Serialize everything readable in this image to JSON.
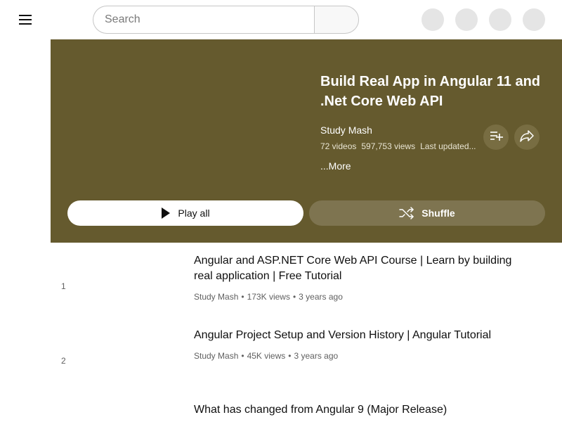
{
  "header": {
    "search_placeholder": "Search"
  },
  "playlist": {
    "title": "Build Real App in Angular 11 and .Net Core Web API",
    "channel": "Study Mash",
    "video_count": "72 videos",
    "views": "597,753 views",
    "last_updated": "Last updated...",
    "more_label": "...More",
    "play_all_label": "Play all",
    "shuffle_label": "Shuffle",
    "background_color": "#655a2e"
  },
  "videos": [
    {
      "index": "1",
      "title": "Angular and ASP.NET Core Web API Course | Learn by building real application | Free Tutorial",
      "channel": "Study Mash",
      "views": "173K views",
      "age": "3 years ago"
    },
    {
      "index": "2",
      "title": "Angular Project Setup and Version History | Angular Tutorial",
      "channel": "Study Mash",
      "views": "45K views",
      "age": "3 years ago"
    },
    {
      "index": "",
      "title": "What has changed from Angular 9 (Major Release)"
    }
  ],
  "icons": [
    "menu-icon",
    "search-icon",
    "add-to-playlist-icon",
    "share-icon",
    "play-icon",
    "shuffle-icon"
  ]
}
